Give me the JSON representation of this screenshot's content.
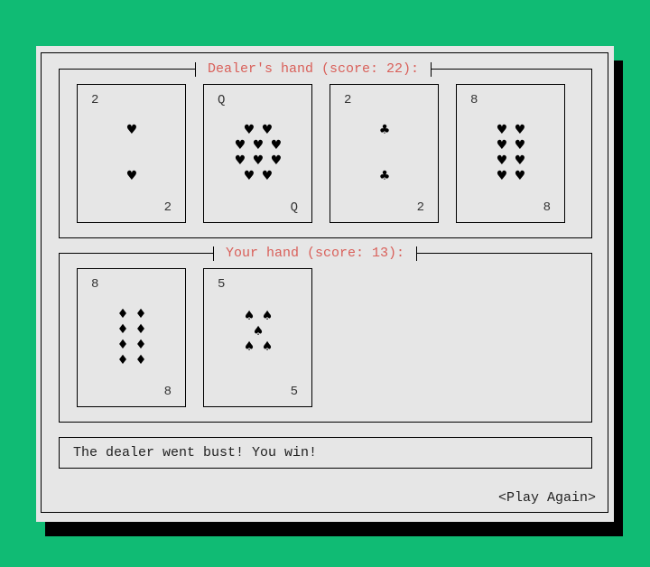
{
  "dealer": {
    "title": "Dealer's hand (score: 22):",
    "cards": [
      {
        "rank": "2",
        "suit": "heart"
      },
      {
        "rank": "Q",
        "suit": "heart"
      },
      {
        "rank": "2",
        "suit": "club"
      },
      {
        "rank": "8",
        "suit": "heart"
      }
    ]
  },
  "player": {
    "title": "Your hand (score: 13):",
    "cards": [
      {
        "rank": "8",
        "suit": "diamond"
      },
      {
        "rank": "5",
        "suit": "spade"
      }
    ]
  },
  "message": "The dealer went bust! You win!",
  "play_again_label": "<Play Again>",
  "suit_glyphs": {
    "heart": "♥",
    "club": "♣",
    "diamond": "♦",
    "spade": "♠"
  }
}
